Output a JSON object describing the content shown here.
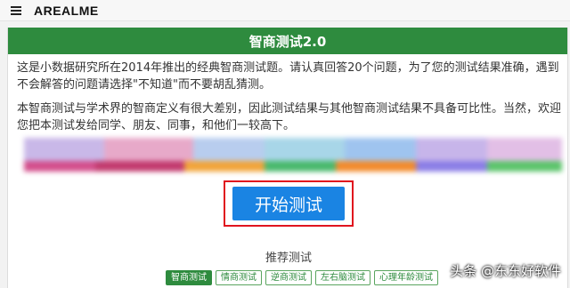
{
  "header": {
    "brand": "AREALME",
    "menu_icon": "hamburger-menu-icon"
  },
  "test": {
    "title": "智商测试2.0",
    "intro": "这是小数据研究所在2014年推出的经典智商测试题。请认真回答20个问题，为了您的测试结果准确，遇到不会解答的问题请选择\"不知道\"而不要胡乱猜测。",
    "notice": "本智商测试与学术界的智商定义有很大差别，因此测试结果与其他智商测试结果不具备可比性。当然，欢迎您把本测试发给同学、朋友、同事，和他们一较高下。",
    "start_label": "开始测试",
    "highlight_color": "#e0141e"
  },
  "recommend": {
    "title": "推荐测试",
    "tags": [
      "智商测试",
      "情商测试",
      "逆商测试",
      "左右脑测试",
      "心理年龄测试"
    ]
  },
  "watermark": "头条 @东东好软件",
  "colors": {
    "header_green": "#2e8b3e",
    "button_blue": "#1a84e3"
  }
}
